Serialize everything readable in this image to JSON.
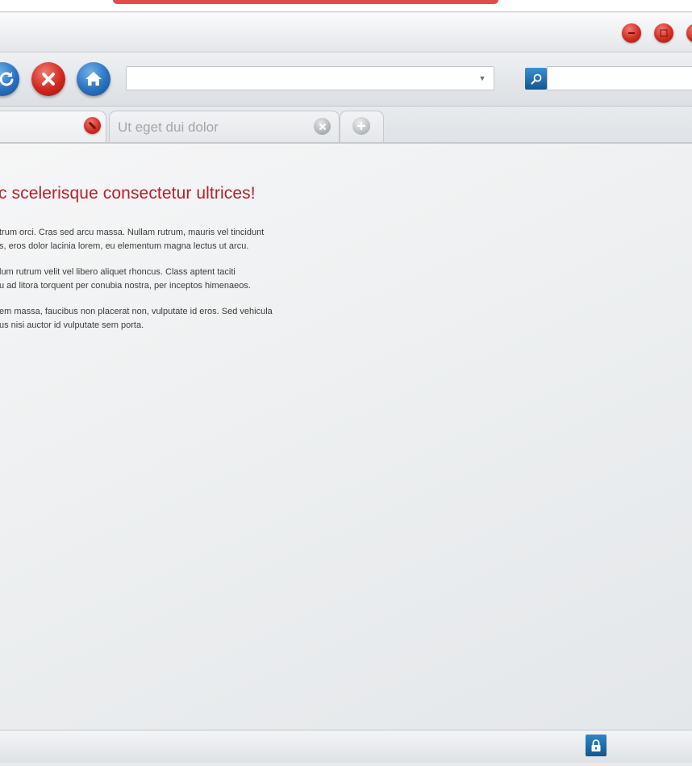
{
  "tabs": [
    {
      "title": "",
      "state": "active"
    },
    {
      "title": "Ut eget dui dolor",
      "state": "inactive"
    }
  ],
  "address_bar": {
    "value": "",
    "placeholder": ""
  },
  "search": {
    "value": "",
    "placeholder": ""
  },
  "content": {
    "heading": "c scelerisque consectetur ultrices!",
    "paragraphs": [
      {
        "line1": "trum orci. Cras sed arcu massa. Nullam rutrum, mauris vel tincidunt",
        "line2": "s, eros dolor lacinia lorem, eu elementum magna lectus ut arcu."
      },
      {
        "line1": "lum rutrum velit vel libero aliquet rhoncus. Class aptent taciti",
        "line2": "u ad litora torquent per conubia nostra, per inceptos himenaeos."
      },
      {
        "line1": "em massa, faucibus non placerat non, vulputate id eros. Sed vehicula",
        "line2": "us nisi auctor id vulputate sem porta."
      }
    ]
  },
  "icons": {
    "refresh": "refresh-icon",
    "stop": "stop-icon",
    "home": "home-icon",
    "search": "search-icon",
    "dropdown": "chevron-down-icon",
    "close_tab": "close-icon",
    "new_tab": "plus-icon",
    "security": "lock-icon"
  },
  "colors": {
    "heading_red": "#b2232c",
    "button_red": "#d22c22",
    "button_blue": "#2a72c0",
    "accent_blue": "#14578f",
    "body_text": "#3c3c3c",
    "tab_text_muted": "#a3a7ac"
  }
}
